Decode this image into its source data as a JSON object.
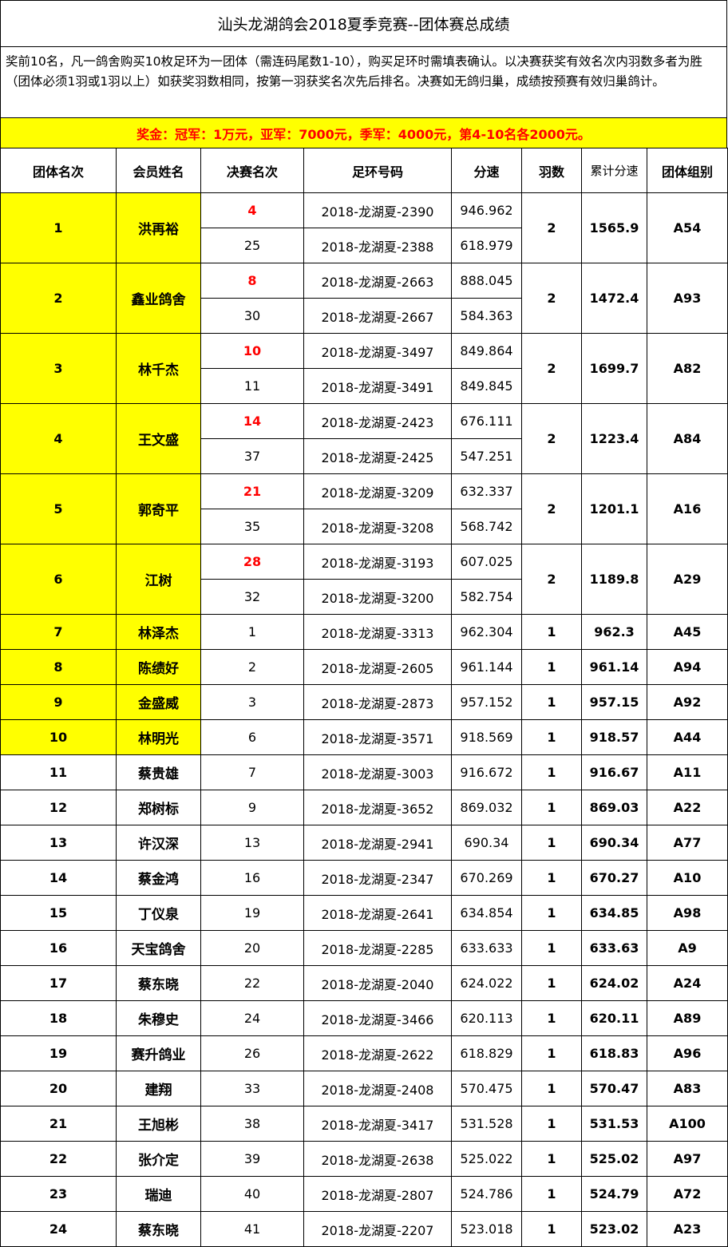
{
  "title": "汕头龙湖鸽会2018夏季竞赛--团体赛总成绩",
  "notice": "奖前10名，凡一鸽舍购买10枚足环为一团体（需连码尾数1-10），购买足环时需填表确认。以决赛获奖有效名次内羽数多者为胜（团体必须1羽或1羽以上）如获奖羽数相同，按第一羽获奖名次先后排名。决赛如无鸽归巢，成绩按预赛有效归巢鸽计。",
  "prize": "奖金：冠军：1万元，亚军：7000元，季军：4000元，第4-10名各2000元。",
  "colors": {
    "highlight": "#ffff00",
    "red_rank": "#ff0000"
  },
  "headers": [
    "团体名次",
    "会员姓名",
    "决赛名次",
    "足环号码",
    "分速",
    "羽数",
    "累计分速",
    "团体组别"
  ],
  "teams": [
    {
      "rank": "1",
      "name": "洪再裕",
      "birds": [
        {
          "final": "4",
          "ring": "2018-龙湖夏-2390",
          "speed": "946.962"
        },
        {
          "final": "25",
          "ring": "2018-龙湖夏-2388",
          "speed": "618.979"
        }
      ],
      "count": "2",
      "total": "1565.9",
      "group": "A54",
      "highlight": true
    },
    {
      "rank": "2",
      "name": "鑫业鸽舍",
      "birds": [
        {
          "final": "8",
          "ring": "2018-龙湖夏-2663",
          "speed": "888.045"
        },
        {
          "final": "30",
          "ring": "2018-龙湖夏-2667",
          "speed": "584.363"
        }
      ],
      "count": "2",
      "total": "1472.4",
      "group": "A93",
      "highlight": true
    },
    {
      "rank": "3",
      "name": "林千杰",
      "birds": [
        {
          "final": "10",
          "ring": "2018-龙湖夏-3497",
          "speed": "849.864"
        },
        {
          "final": "11",
          "ring": "2018-龙湖夏-3491",
          "speed": "849.845"
        }
      ],
      "count": "2",
      "total": "1699.7",
      "group": "A82",
      "highlight": true
    },
    {
      "rank": "4",
      "name": "王文盛",
      "birds": [
        {
          "final": "14",
          "ring": "2018-龙湖夏-2423",
          "speed": "676.111"
        },
        {
          "final": "37",
          "ring": "2018-龙湖夏-2425",
          "speed": "547.251"
        }
      ],
      "count": "2",
      "total": "1223.4",
      "group": "A84",
      "highlight": true
    },
    {
      "rank": "5",
      "name": "郭奇平",
      "birds": [
        {
          "final": "21",
          "ring": "2018-龙湖夏-3209",
          "speed": "632.337"
        },
        {
          "final": "35",
          "ring": "2018-龙湖夏-3208",
          "speed": "568.742"
        }
      ],
      "count": "2",
      "total": "1201.1",
      "group": "A16",
      "highlight": true
    },
    {
      "rank": "6",
      "name": "江树",
      "birds": [
        {
          "final": "28",
          "ring": "2018-龙湖夏-3193",
          "speed": "607.025"
        },
        {
          "final": "32",
          "ring": "2018-龙湖夏-3200",
          "speed": "582.754"
        }
      ],
      "count": "2",
      "total": "1189.8",
      "group": "A29",
      "highlight": true
    },
    {
      "rank": "7",
      "name": "林泽杰",
      "birds": [
        {
          "final": "1",
          "ring": "2018-龙湖夏-3313",
          "speed": "962.304"
        }
      ],
      "count": "1",
      "total": "962.3",
      "group": "A45",
      "highlight": true
    },
    {
      "rank": "8",
      "name": "陈绩好",
      "birds": [
        {
          "final": "2",
          "ring": "2018-龙湖夏-2605",
          "speed": "961.144"
        }
      ],
      "count": "1",
      "total": "961.14",
      "group": "A94",
      "highlight": true
    },
    {
      "rank": "9",
      "name": "金盛威",
      "birds": [
        {
          "final": "3",
          "ring": "2018-龙湖夏-2873",
          "speed": "957.152"
        }
      ],
      "count": "1",
      "total": "957.15",
      "group": "A92",
      "highlight": true
    },
    {
      "rank": "10",
      "name": "林明光",
      "birds": [
        {
          "final": "6",
          "ring": "2018-龙湖夏-3571",
          "speed": "918.569"
        }
      ],
      "count": "1",
      "total": "918.57",
      "group": "A44",
      "highlight": true
    },
    {
      "rank": "11",
      "name": "蔡贵雄",
      "birds": [
        {
          "final": "7",
          "ring": "2018-龙湖夏-3003",
          "speed": "916.672"
        }
      ],
      "count": "1",
      "total": "916.67",
      "group": "A11",
      "highlight": false
    },
    {
      "rank": "12",
      "name": "郑树标",
      "birds": [
        {
          "final": "9",
          "ring": "2018-龙湖夏-3652",
          "speed": "869.032"
        }
      ],
      "count": "1",
      "total": "869.03",
      "group": "A22",
      "highlight": false
    },
    {
      "rank": "13",
      "name": "许汉深",
      "birds": [
        {
          "final": "13",
          "ring": "2018-龙湖夏-2941",
          "speed": "690.34"
        }
      ],
      "count": "1",
      "total": "690.34",
      "group": "A77",
      "highlight": false
    },
    {
      "rank": "14",
      "name": "蔡金鸿",
      "birds": [
        {
          "final": "16",
          "ring": "2018-龙湖夏-2347",
          "speed": "670.269"
        }
      ],
      "count": "1",
      "total": "670.27",
      "group": "A10",
      "highlight": false
    },
    {
      "rank": "15",
      "name": "丁仪泉",
      "birds": [
        {
          "final": "19",
          "ring": "2018-龙湖夏-2641",
          "speed": "634.854"
        }
      ],
      "count": "1",
      "total": "634.85",
      "group": "A98",
      "highlight": false
    },
    {
      "rank": "16",
      "name": "天宝鸽舍",
      "birds": [
        {
          "final": "20",
          "ring": "2018-龙湖夏-2285",
          "speed": "633.633"
        }
      ],
      "count": "1",
      "total": "633.63",
      "group": "A9",
      "highlight": false
    },
    {
      "rank": "17",
      "name": "蔡东晓",
      "birds": [
        {
          "final": "22",
          "ring": "2018-龙湖夏-2040",
          "speed": "624.022"
        }
      ],
      "count": "1",
      "total": "624.02",
      "group": "A24",
      "highlight": false
    },
    {
      "rank": "18",
      "name": "朱穆史",
      "birds": [
        {
          "final": "24",
          "ring": "2018-龙湖夏-3466",
          "speed": "620.113"
        }
      ],
      "count": "1",
      "total": "620.11",
      "group": "A89",
      "highlight": false
    },
    {
      "rank": "19",
      "name": "赛升鸽业",
      "birds": [
        {
          "final": "26",
          "ring": "2018-龙湖夏-2622",
          "speed": "618.829"
        }
      ],
      "count": "1",
      "total": "618.83",
      "group": "A96",
      "highlight": false
    },
    {
      "rank": "20",
      "name": "建翔",
      "birds": [
        {
          "final": "33",
          "ring": "2018-龙湖夏-2408",
          "speed": "570.475"
        }
      ],
      "count": "1",
      "total": "570.47",
      "group": "A83",
      "highlight": false
    },
    {
      "rank": "21",
      "name": "王旭彬",
      "birds": [
        {
          "final": "38",
          "ring": "2018-龙湖夏-3417",
          "speed": "531.528"
        }
      ],
      "count": "1",
      "total": "531.53",
      "group": "A100",
      "highlight": false
    },
    {
      "rank": "22",
      "name": "张介定",
      "birds": [
        {
          "final": "39",
          "ring": "2018-龙湖夏-2638",
          "speed": "525.022"
        }
      ],
      "count": "1",
      "total": "525.02",
      "group": "A97",
      "highlight": false
    },
    {
      "rank": "23",
      "name": "瑞迪",
      "birds": [
        {
          "final": "40",
          "ring": "2018-龙湖夏-2807",
          "speed": "524.786"
        }
      ],
      "count": "1",
      "total": "524.79",
      "group": "A72",
      "highlight": false
    },
    {
      "rank": "24",
      "name": "蔡东晓",
      "birds": [
        {
          "final": "41",
          "ring": "2018-龙湖夏-2207",
          "speed": "523.018"
        }
      ],
      "count": "1",
      "total": "523.02",
      "group": "A23",
      "highlight": false
    }
  ]
}
